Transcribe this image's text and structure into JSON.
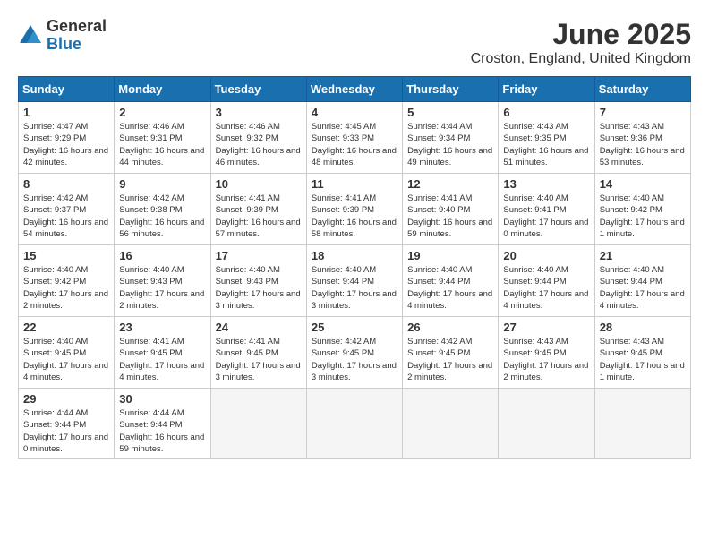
{
  "logo": {
    "general": "General",
    "blue": "Blue"
  },
  "title": "June 2025",
  "location": "Croston, England, United Kingdom",
  "weekdays": [
    "Sunday",
    "Monday",
    "Tuesday",
    "Wednesday",
    "Thursday",
    "Friday",
    "Saturday"
  ],
  "weeks": [
    [
      {
        "day": "1",
        "sunrise": "4:47 AM",
        "sunset": "9:29 PM",
        "daylight": "16 hours and 42 minutes."
      },
      {
        "day": "2",
        "sunrise": "4:46 AM",
        "sunset": "9:31 PM",
        "daylight": "16 hours and 44 minutes."
      },
      {
        "day": "3",
        "sunrise": "4:46 AM",
        "sunset": "9:32 PM",
        "daylight": "16 hours and 46 minutes."
      },
      {
        "day": "4",
        "sunrise": "4:45 AM",
        "sunset": "9:33 PM",
        "daylight": "16 hours and 48 minutes."
      },
      {
        "day": "5",
        "sunrise": "4:44 AM",
        "sunset": "9:34 PM",
        "daylight": "16 hours and 49 minutes."
      },
      {
        "day": "6",
        "sunrise": "4:43 AM",
        "sunset": "9:35 PM",
        "daylight": "16 hours and 51 minutes."
      },
      {
        "day": "7",
        "sunrise": "4:43 AM",
        "sunset": "9:36 PM",
        "daylight": "16 hours and 53 minutes."
      }
    ],
    [
      {
        "day": "8",
        "sunrise": "4:42 AM",
        "sunset": "9:37 PM",
        "daylight": "16 hours and 54 minutes."
      },
      {
        "day": "9",
        "sunrise": "4:42 AM",
        "sunset": "9:38 PM",
        "daylight": "16 hours and 56 minutes."
      },
      {
        "day": "10",
        "sunrise": "4:41 AM",
        "sunset": "9:39 PM",
        "daylight": "16 hours and 57 minutes."
      },
      {
        "day": "11",
        "sunrise": "4:41 AM",
        "sunset": "9:39 PM",
        "daylight": "16 hours and 58 minutes."
      },
      {
        "day": "12",
        "sunrise": "4:41 AM",
        "sunset": "9:40 PM",
        "daylight": "16 hours and 59 minutes."
      },
      {
        "day": "13",
        "sunrise": "4:40 AM",
        "sunset": "9:41 PM",
        "daylight": "17 hours and 0 minutes."
      },
      {
        "day": "14",
        "sunrise": "4:40 AM",
        "sunset": "9:42 PM",
        "daylight": "17 hours and 1 minute."
      }
    ],
    [
      {
        "day": "15",
        "sunrise": "4:40 AM",
        "sunset": "9:42 PM",
        "daylight": "17 hours and 2 minutes."
      },
      {
        "day": "16",
        "sunrise": "4:40 AM",
        "sunset": "9:43 PM",
        "daylight": "17 hours and 2 minutes."
      },
      {
        "day": "17",
        "sunrise": "4:40 AM",
        "sunset": "9:43 PM",
        "daylight": "17 hours and 3 minutes."
      },
      {
        "day": "18",
        "sunrise": "4:40 AM",
        "sunset": "9:44 PM",
        "daylight": "17 hours and 3 minutes."
      },
      {
        "day": "19",
        "sunrise": "4:40 AM",
        "sunset": "9:44 PM",
        "daylight": "17 hours and 4 minutes."
      },
      {
        "day": "20",
        "sunrise": "4:40 AM",
        "sunset": "9:44 PM",
        "daylight": "17 hours and 4 minutes."
      },
      {
        "day": "21",
        "sunrise": "4:40 AM",
        "sunset": "9:44 PM",
        "daylight": "17 hours and 4 minutes."
      }
    ],
    [
      {
        "day": "22",
        "sunrise": "4:40 AM",
        "sunset": "9:45 PM",
        "daylight": "17 hours and 4 minutes."
      },
      {
        "day": "23",
        "sunrise": "4:41 AM",
        "sunset": "9:45 PM",
        "daylight": "17 hours and 4 minutes."
      },
      {
        "day": "24",
        "sunrise": "4:41 AM",
        "sunset": "9:45 PM",
        "daylight": "17 hours and 3 minutes."
      },
      {
        "day": "25",
        "sunrise": "4:42 AM",
        "sunset": "9:45 PM",
        "daylight": "17 hours and 3 minutes."
      },
      {
        "day": "26",
        "sunrise": "4:42 AM",
        "sunset": "9:45 PM",
        "daylight": "17 hours and 2 minutes."
      },
      {
        "day": "27",
        "sunrise": "4:43 AM",
        "sunset": "9:45 PM",
        "daylight": "17 hours and 2 minutes."
      },
      {
        "day": "28",
        "sunrise": "4:43 AM",
        "sunset": "9:45 PM",
        "daylight": "17 hours and 1 minute."
      }
    ],
    [
      {
        "day": "29",
        "sunrise": "4:44 AM",
        "sunset": "9:44 PM",
        "daylight": "17 hours and 0 minutes."
      },
      {
        "day": "30",
        "sunrise": "4:44 AM",
        "sunset": "9:44 PM",
        "daylight": "16 hours and 59 minutes."
      },
      null,
      null,
      null,
      null,
      null
    ]
  ]
}
